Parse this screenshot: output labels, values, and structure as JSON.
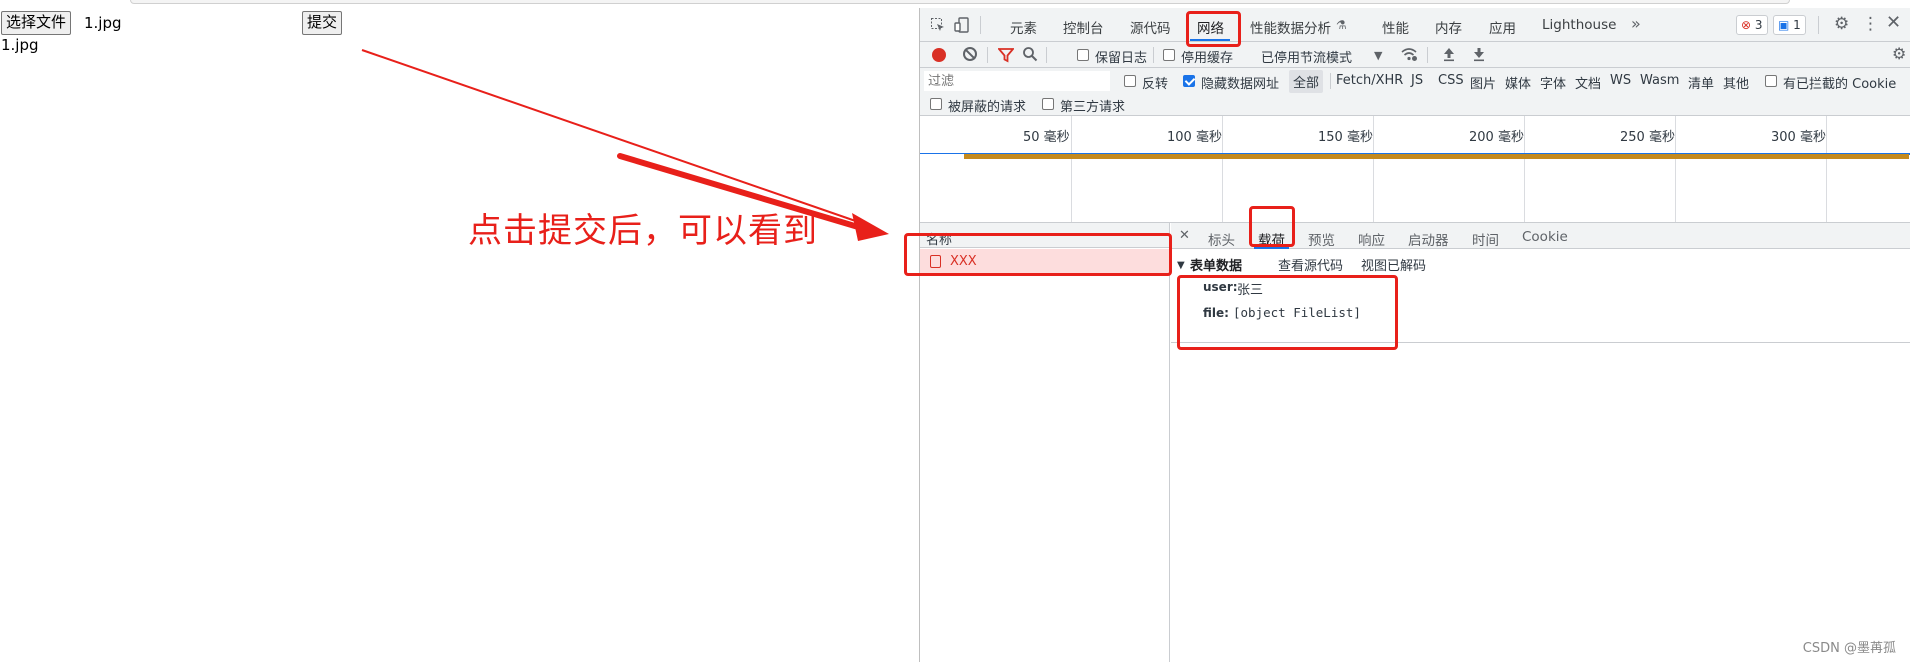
{
  "page": {
    "choose_file_button": "选择文件",
    "chosen_file_name": "1.jpg",
    "submit_button": "提交",
    "uploaded_text": "1.jpg"
  },
  "annotation": {
    "text": "点击提交后，可以看到",
    "color": "#e8201a"
  },
  "devtools": {
    "tabs": [
      {
        "label": "元素"
      },
      {
        "label": "控制台"
      },
      {
        "label": "源代码"
      },
      {
        "label": "网络"
      },
      {
        "label": "性能数据分析"
      },
      {
        "label": "性能"
      },
      {
        "label": "内存"
      },
      {
        "label": "应用"
      },
      {
        "label": "Lighthouse"
      }
    ],
    "badges": {
      "errors": "3",
      "messages": "1"
    },
    "toolbar": {
      "preserve_log": "保留日志",
      "disable_cache": "停用缓存",
      "throttling": "已停用节流模式"
    },
    "filter": {
      "placeholder": "过滤",
      "invert": "反转",
      "hide_data_urls": "隐藏数据网址",
      "all": "全部",
      "types": [
        "Fetch/XHR",
        "JS",
        "CSS",
        "图片",
        "媒体",
        "字体",
        "文档",
        "WS",
        "Wasm",
        "清单",
        "其他"
      ],
      "blocked_cookies": "有已拦截的 Cookie",
      "blocked_requests": "被屏蔽的请求",
      "third_party": "第三方请求"
    },
    "timeline_ticks": [
      "50 毫秒",
      "100 毫秒",
      "150 毫秒",
      "200 毫秒",
      "250 毫秒",
      "300 毫秒"
    ],
    "requests": {
      "name_header": "名称",
      "items": [
        {
          "name": "XXX",
          "status": "error"
        }
      ]
    },
    "detail": {
      "tabs": [
        "标头",
        "载荷",
        "预览",
        "响应",
        "启动器",
        "时间",
        "Cookie"
      ],
      "selected_tab": "载荷",
      "section_title": "表单数据",
      "view_source": "查看源代码",
      "view_decoded": "视图已解码",
      "fields": [
        {
          "key": "user:",
          "value": "张三"
        },
        {
          "key": "file:",
          "value": "[object FileList]"
        }
      ]
    }
  },
  "watermark": "CSDN @墨苒孤",
  "colors": {
    "accent": "#1a73e8",
    "error": "#d93025",
    "highlight": "#e8201a"
  }
}
